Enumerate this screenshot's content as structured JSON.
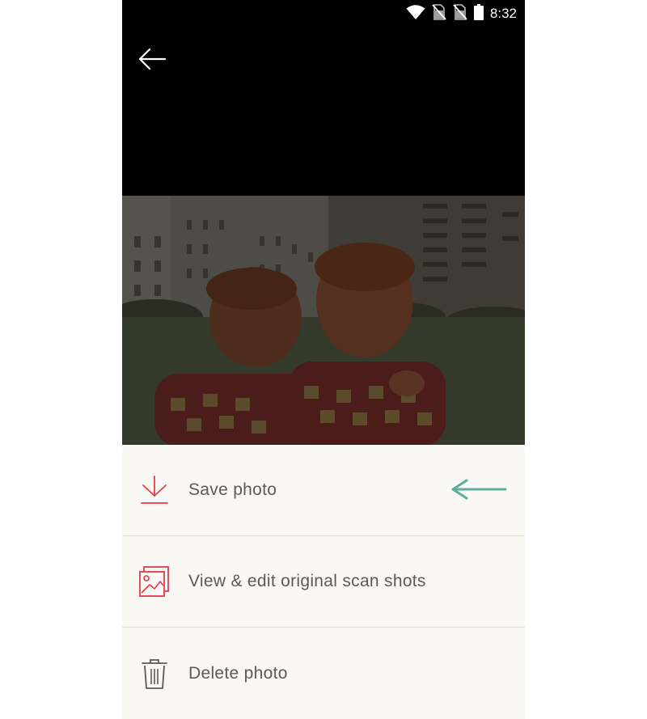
{
  "status_bar": {
    "time": "8:32"
  },
  "icons": {
    "back": "back-arrow-icon",
    "save": "download-icon",
    "view_edit": "photos-icon",
    "delete": "trash-icon",
    "hint": "teal-left-arrow-icon"
  },
  "colors": {
    "accent": "#e53a4a",
    "hint_arrow": "#5fae9c",
    "sheet_bg": "#f9f8f4",
    "label_text": "#5d5a55"
  },
  "menu": {
    "items": [
      {
        "label": "Save photo"
      },
      {
        "label": "View & edit original scan shots"
      },
      {
        "label": "Delete photo"
      }
    ]
  }
}
